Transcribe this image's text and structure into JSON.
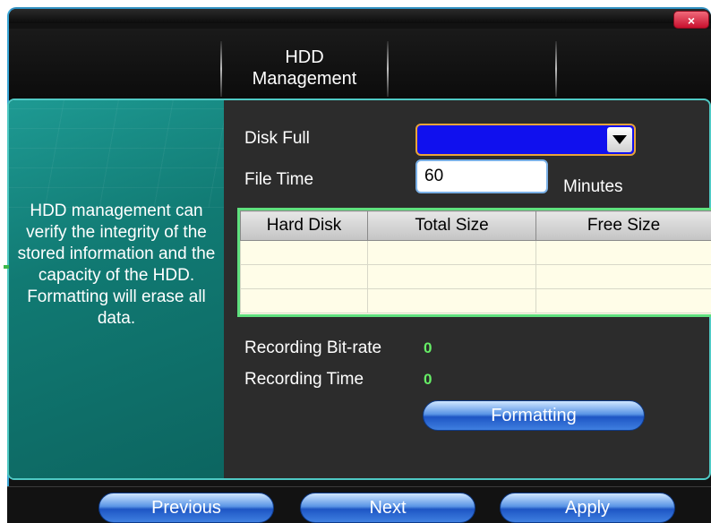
{
  "window": {
    "close_label": "×"
  },
  "tabs": [
    {
      "label": "HDD\nManagement",
      "active": true
    }
  ],
  "side_panel": {
    "description": "HDD management can verify the integrity of the stored information and the capacity of the HDD. Formatting will erase all data."
  },
  "form": {
    "disk_full_label": "Disk Full",
    "disk_full_value": "",
    "file_time_label": "File Time",
    "file_time_value": "60",
    "file_time_unit": "Minutes"
  },
  "disk_table": {
    "headers": [
      "Hard Disk",
      "Total Size",
      "Free Size"
    ],
    "rows": [
      [
        "",
        "",
        ""
      ],
      [
        "",
        "",
        ""
      ],
      [
        "",
        "",
        ""
      ]
    ]
  },
  "stats": {
    "recording_bitrate_label": "Recording Bit-rate",
    "recording_bitrate_value": "0",
    "recording_time_label": "Recording Time",
    "recording_time_value": "0"
  },
  "buttons": {
    "formatting_label": "Formatting",
    "previous_label": "Previous",
    "next_label": "Next",
    "apply_label": "Apply"
  },
  "colors": {
    "accent_teal": "#1e9a93",
    "dropdown_blue": "#1010ee",
    "value_green": "#66ee66",
    "close_red": "#c8102e"
  }
}
